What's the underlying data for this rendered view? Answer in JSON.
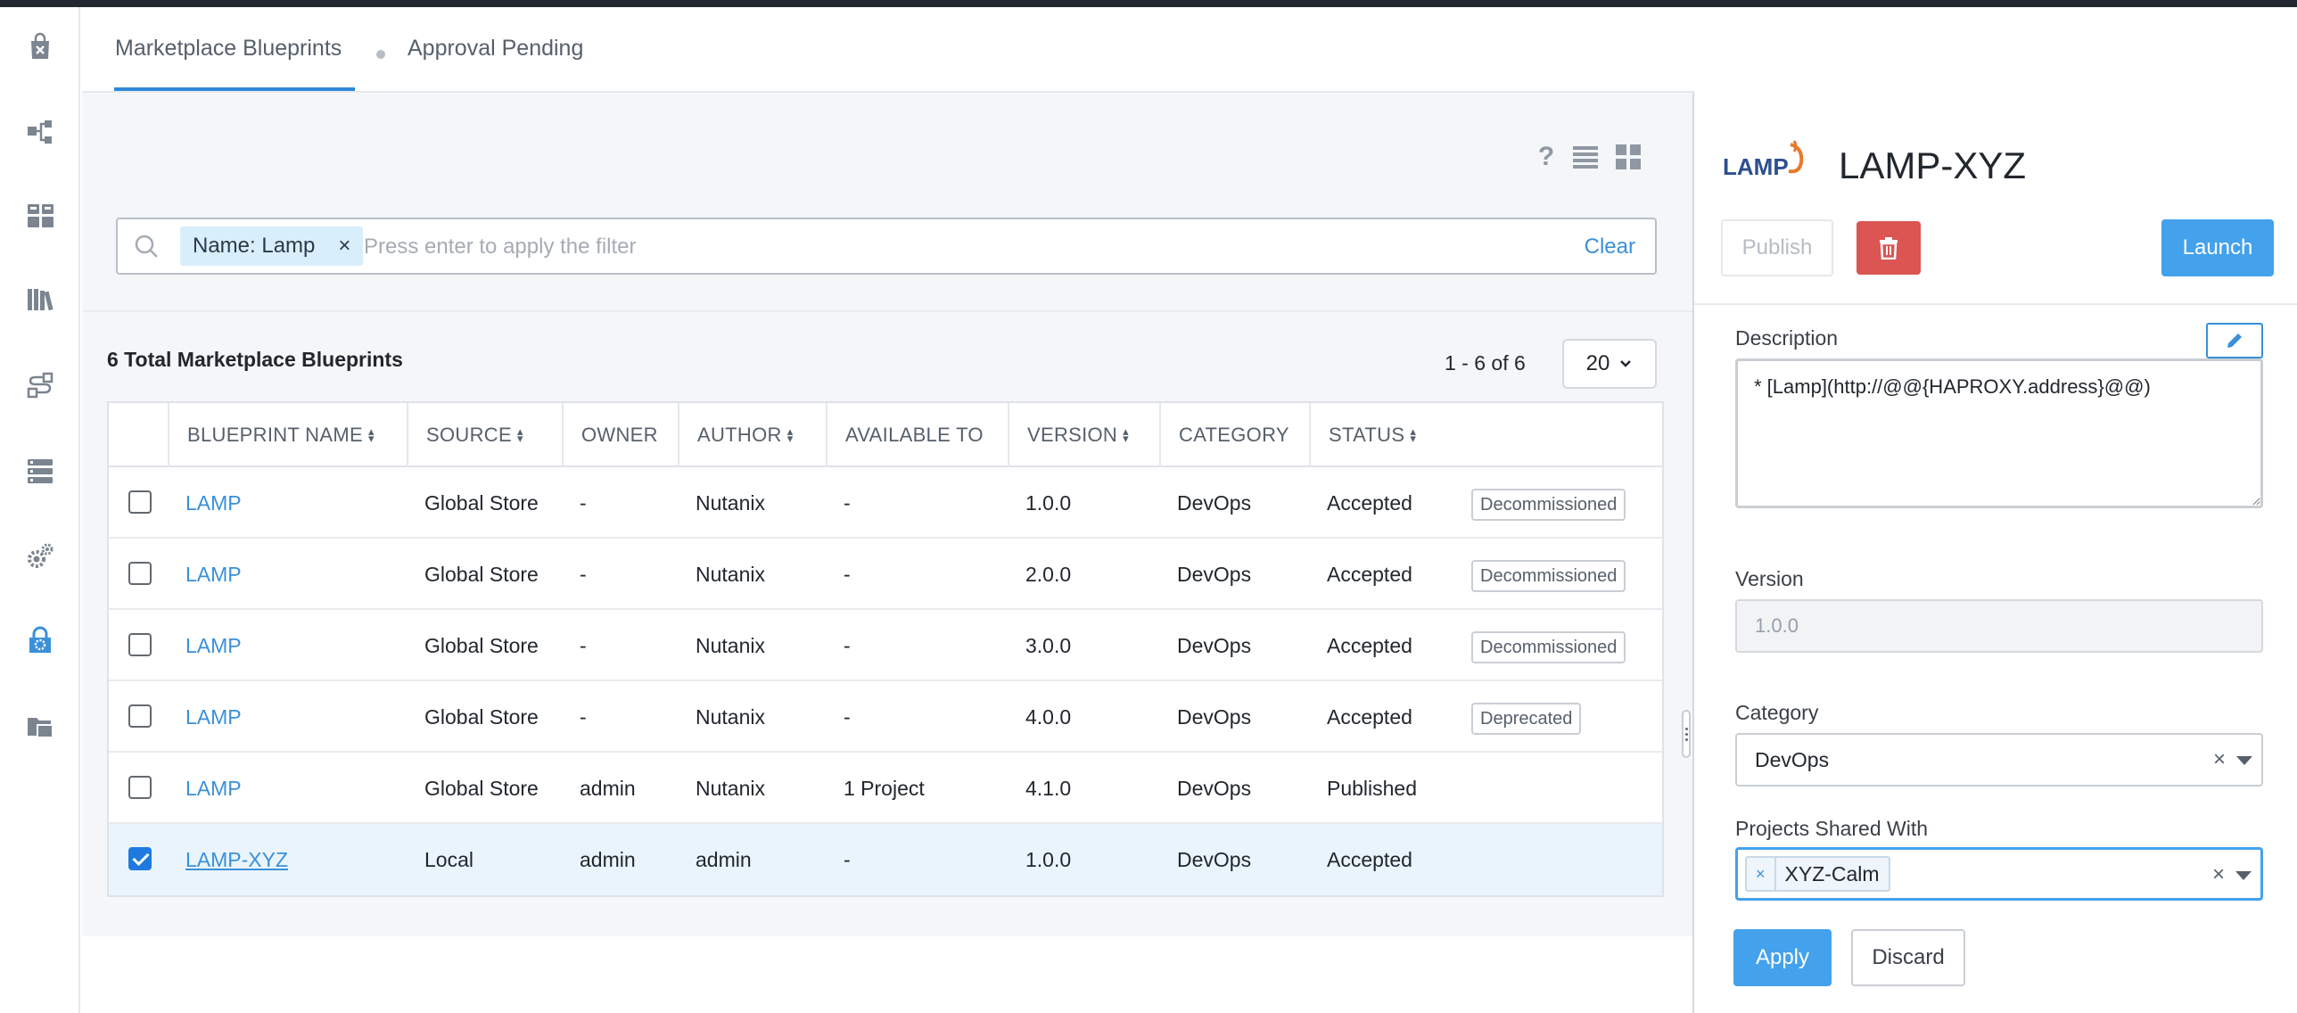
{
  "tabs": [
    {
      "label": "Marketplace Blueprints",
      "active": true
    },
    {
      "label": "Approval Pending",
      "active": false
    }
  ],
  "sidebar": {
    "icons": [
      "marketplace-bag-icon",
      "blueprint-tree-icon",
      "applications-grid-icon",
      "library-books-icon",
      "runbook-icon",
      "endpoints-list-icon",
      "settings-gears-icon",
      "marketplace-manager-lock-icon",
      "projects-folder-icon"
    ],
    "active": "marketplace-manager-lock-icon"
  },
  "toolbar": {
    "help_icon": "?",
    "list_view_icon": "list-icon",
    "grid_view_icon": "grid-icon"
  },
  "filter": {
    "chip_label": "Name: Lamp",
    "chip_remove": "×",
    "placeholder": "Press enter to apply the filter",
    "clear_label": "Clear"
  },
  "summary": {
    "total_label": "6 Total Marketplace Blueprints",
    "pager_text": "1 - 6 of 6",
    "per_page": "20"
  },
  "table": {
    "columns": [
      "BLUEPRINT NAME",
      "SOURCE",
      "OWNER",
      "AUTHOR",
      "AVAILABLE TO",
      "VERSION",
      "CATEGORY",
      "STATUS"
    ],
    "rows": [
      {
        "checked": false,
        "name": "LAMP",
        "source": "Global Store",
        "owner": "-",
        "author": "Nutanix",
        "available_to": "-",
        "version": "1.0.0",
        "category": "DevOps",
        "status": "Accepted",
        "badge": "Decommissioned"
      },
      {
        "checked": false,
        "name": "LAMP",
        "source": "Global Store",
        "owner": "-",
        "author": "Nutanix",
        "available_to": "-",
        "version": "2.0.0",
        "category": "DevOps",
        "status": "Accepted",
        "badge": "Decommissioned"
      },
      {
        "checked": false,
        "name": "LAMP",
        "source": "Global Store",
        "owner": "-",
        "author": "Nutanix",
        "available_to": "-",
        "version": "3.0.0",
        "category": "DevOps",
        "status": "Accepted",
        "badge": "Decommissioned"
      },
      {
        "checked": false,
        "name": "LAMP",
        "source": "Global Store",
        "owner": "-",
        "author": "Nutanix",
        "available_to": "-",
        "version": "4.0.0",
        "category": "DevOps",
        "status": "Accepted",
        "badge": "Deprecated"
      },
      {
        "checked": false,
        "name": "LAMP",
        "source": "Global Store",
        "owner": "admin",
        "author": "Nutanix",
        "available_to": "1 Project",
        "version": "4.1.0",
        "category": "DevOps",
        "status": "Published",
        "badge": ""
      },
      {
        "checked": true,
        "name": "LAMP-XYZ",
        "source": "Local",
        "owner": "admin",
        "author": "admin",
        "available_to": "-",
        "version": "1.0.0",
        "category": "DevOps",
        "status": "Accepted",
        "badge": ""
      }
    ]
  },
  "panel": {
    "logo_text": "LAMP",
    "title": "LAMP-XYZ",
    "publish_label": "Publish",
    "delete_icon": "trash-icon",
    "launch_label": "Launch",
    "description_label": "Description",
    "description_value": "* [Lamp](http://@@{HAPROXY.address}@@)",
    "version_label": "Version",
    "version_value": "1.0.0",
    "category_label": "Category",
    "category_value": "DevOps",
    "projects_label": "Projects Shared With",
    "projects_tag": "XYZ-Calm",
    "tag_remove": "×",
    "select_clear": "×",
    "apply_label": "Apply",
    "discard_label": "Discard"
  },
  "colors": {
    "accent": "#44a1ec",
    "link": "#3a90d9",
    "danger": "#db5553",
    "chip": "#d9eefb"
  }
}
